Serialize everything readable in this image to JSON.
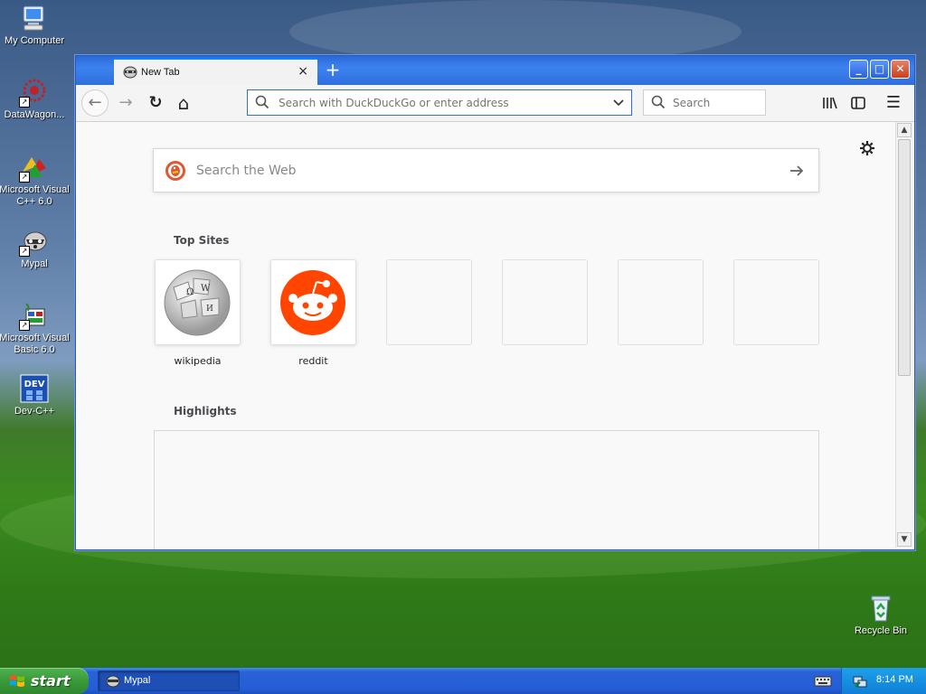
{
  "desktop": {
    "icons": [
      {
        "label": "My Computer"
      },
      {
        "label": "DataWagon..."
      },
      {
        "label": "Microsoft Visual C++ 6.0"
      },
      {
        "label": "Mypal"
      },
      {
        "label": "Microsoft Visual Basic 6.0"
      },
      {
        "label": "Dev-C++"
      },
      {
        "label": "Recycle Bin"
      }
    ]
  },
  "browser": {
    "tab": {
      "title": "New Tab",
      "close_label": "×"
    },
    "new_tab_label": "+",
    "window_buttons": {
      "minimize": "_",
      "maximize": "□",
      "close": "✕"
    },
    "toolbar": {
      "back": "←",
      "forward": "→",
      "reload": "↻",
      "home": "⌂",
      "url_placeholder": "Search with DuckDuckGo or enter address",
      "search_placeholder": "Search",
      "library": "|||\\",
      "sidebar": "▯",
      "menu": "☰"
    },
    "newtab": {
      "web_search_placeholder": "Search the Web",
      "top_sites_title": "Top Sites",
      "top_sites": [
        {
          "label": "wikipedia"
        },
        {
          "label": "reddit"
        },
        {
          "label": ""
        },
        {
          "label": ""
        },
        {
          "label": ""
        },
        {
          "label": ""
        }
      ],
      "highlights_title": "Highlights"
    }
  },
  "taskbar": {
    "start_label": "start",
    "task_label": "Mypal",
    "clock": "8:14 PM"
  },
  "colors": {
    "accent": "#0a84ff",
    "reddit": "#ff4500",
    "taskbar_blue": "#245dd6",
    "start_green": "#3a9a3a"
  }
}
